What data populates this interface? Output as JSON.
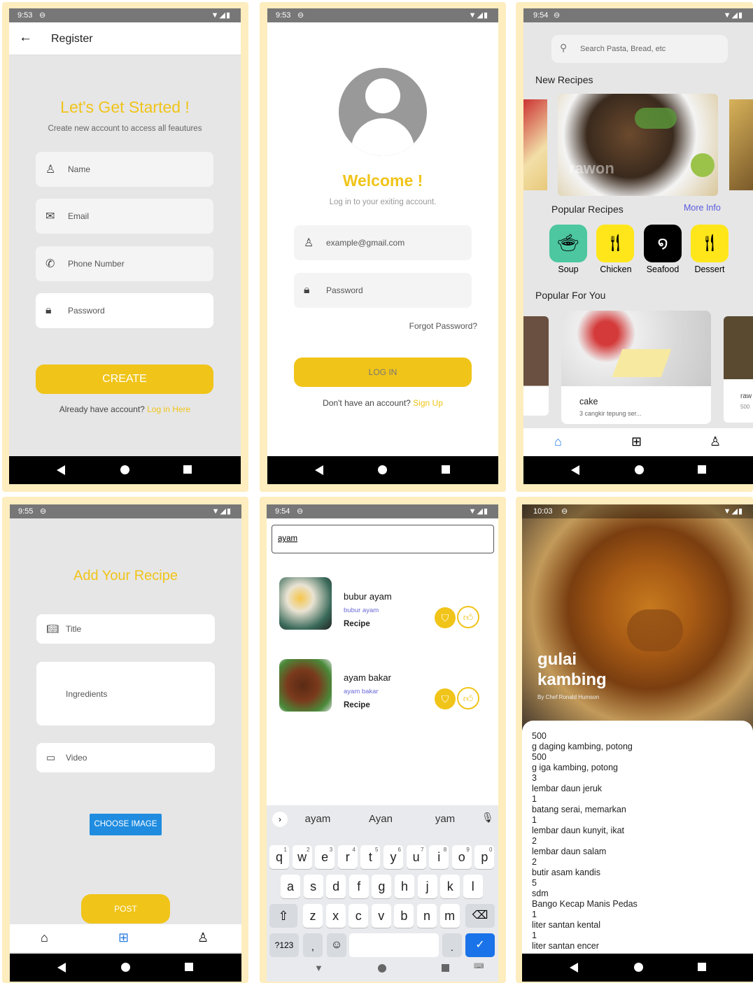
{
  "screens": {
    "register": {
      "time": "9:53",
      "title": "Register",
      "heading": "Let's Get Started !",
      "subtitle": "Create new account to access all feautures",
      "fields": [
        "Name",
        "Email",
        "Phone Number",
        "Password"
      ],
      "button": "CREATE",
      "footer_text": "Already have account? ",
      "footer_link": "Log in Here"
    },
    "login": {
      "time": "9:53",
      "heading": "Welcome !",
      "subtitle": "Log in to your exiting account.",
      "email_placeholder": "example@gmail.com",
      "password_placeholder": "Password",
      "forgot": "Forgot Password?",
      "button": "LOG IN",
      "footer_text": "Don't have an account? ",
      "footer_link": "Sign Up"
    },
    "home": {
      "time": "9:54",
      "search_placeholder": "Search Pasta, Bread, etc",
      "new_recipes": "New Recipes",
      "banner_text": "rawon",
      "popular_recipes": "Popular Recipes",
      "more_info": "More Info",
      "categories": [
        "Soup",
        "Chicken",
        "Seafood",
        "Dessert"
      ],
      "popular_for_you": "Popular For You",
      "card_title": "cake",
      "card_desc": "3 cangkir tepung ser...",
      "side_card_title": "raw",
      "side_card_sub": "500"
    },
    "add": {
      "time": "9:55",
      "heading": "Add Your Recipe",
      "fields": [
        "Title",
        "Ingredients",
        "Video"
      ],
      "choose": "CHOOSE IMAGE",
      "post": "POST"
    },
    "search": {
      "time": "9:54",
      "query": "ayam",
      "results": [
        {
          "title": "bubur ayam",
          "sub": "bubur ayam",
          "type": "Recipe"
        },
        {
          "title": "ayam bakar",
          "sub": "ayam bakar",
          "type": "Recipe"
        }
      ],
      "suggestions": [
        "ayam",
        "Ayan",
        "yam"
      ],
      "row1": [
        "q",
        "w",
        "e",
        "r",
        "t",
        "y",
        "u",
        "i",
        "o",
        "p"
      ],
      "row1_num": [
        "1",
        "2",
        "3",
        "4",
        "5",
        "6",
        "7",
        "8",
        "9",
        "0"
      ],
      "row2": [
        "a",
        "s",
        "d",
        "f",
        "g",
        "h",
        "j",
        "k",
        "l"
      ],
      "row3": [
        "z",
        "x",
        "c",
        "v",
        "b",
        "n",
        "m"
      ],
      "sym": "?123",
      "comma": ",",
      "period": "."
    },
    "detail": {
      "time": "10:03",
      "title_line1": "gulai",
      "title_line2": "kambing",
      "author": "By Chef Ronald Humson",
      "ingredients": [
        "500",
        "g daging kambing, potong",
        "500",
        "g iga kambing, potong",
        "3",
        "lembar daun jeruk",
        "1",
        "batang serai, memarkan",
        "1",
        "lembar daun kunyit, ikat",
        "2",
        "lembar daun salam",
        "2",
        "butir asam kandis",
        "5",
        "sdm",
        "Bango Kecap Manis Pedas",
        "1",
        "liter santan kental",
        "1",
        "liter santan encer"
      ]
    }
  },
  "colors": {
    "accent": "#f0c419",
    "statusbar": "#777777",
    "nav": "#000000",
    "frame": "#fdedbf",
    "bg": "#e6e6e6"
  }
}
